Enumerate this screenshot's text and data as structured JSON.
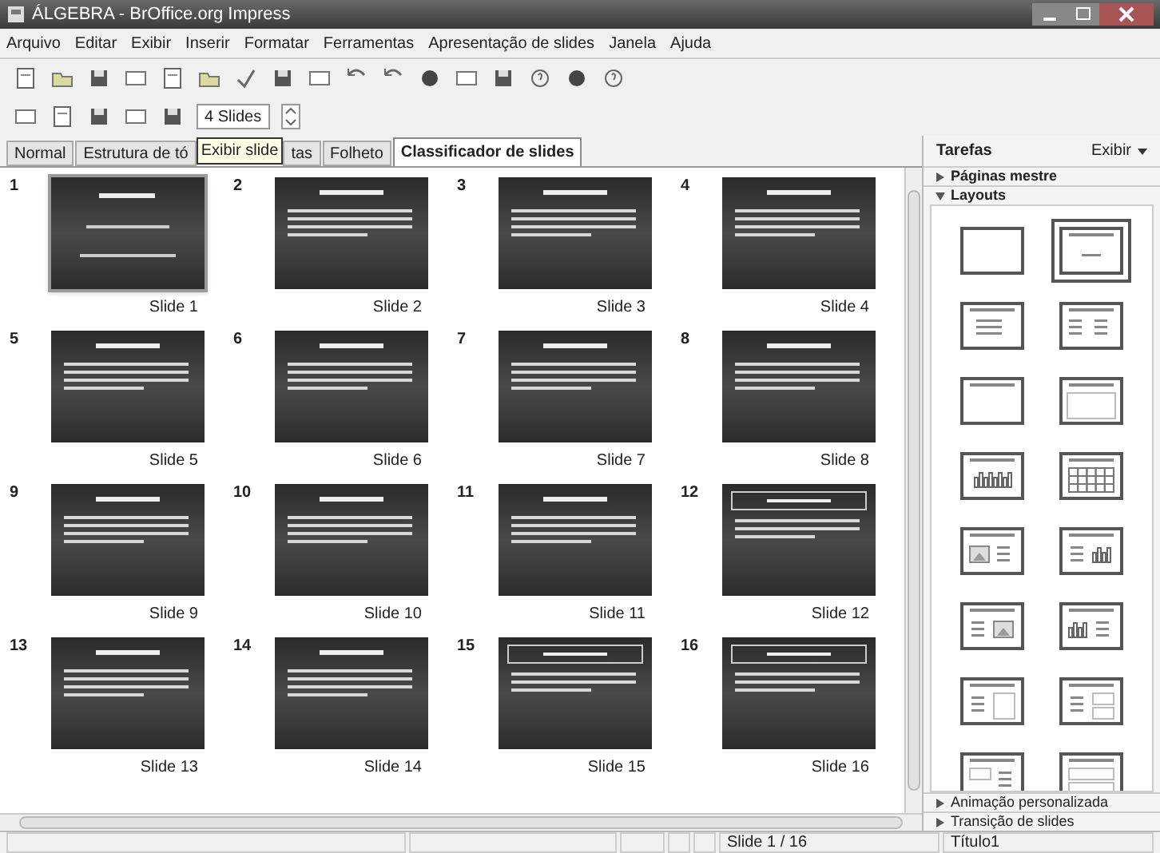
{
  "window": {
    "title": "ÁLGEBRA - BrOffice.org Impress"
  },
  "menu": [
    "Arquivo",
    "Editar",
    "Exibir",
    "Inserir",
    "Formatar",
    "Ferramentas",
    "Apresentação de slides",
    "Janela",
    "Ajuda"
  ],
  "toolbar2": {
    "slides_per_row": "4 Slides"
  },
  "tabs": [
    {
      "label": "Normal",
      "selected": false
    },
    {
      "label": "Estrutura de tó",
      "selected": false
    },
    {
      "label": "tas",
      "selected": false
    },
    {
      "label": "Folheto",
      "selected": false
    },
    {
      "label": "Classificador de slides",
      "selected": true
    }
  ],
  "tooltip": "Exibir slide",
  "slides": [
    {
      "number": "1",
      "label": "Slide 1",
      "kind": "title",
      "selected": true
    },
    {
      "number": "2",
      "label": "Slide 2",
      "kind": "bullets",
      "selected": false
    },
    {
      "number": "3",
      "label": "Slide 3",
      "kind": "bullets",
      "selected": false
    },
    {
      "number": "4",
      "label": "Slide 4",
      "kind": "bullets",
      "selected": false
    },
    {
      "number": "5",
      "label": "Slide 5",
      "kind": "bullets",
      "selected": false
    },
    {
      "number": "6",
      "label": "Slide 6",
      "kind": "bullets",
      "selected": false
    },
    {
      "number": "7",
      "label": "Slide 7",
      "kind": "bullets",
      "selected": false
    },
    {
      "number": "8",
      "label": "Slide 8",
      "kind": "bullets",
      "selected": false
    },
    {
      "number": "9",
      "label": "Slide 9",
      "kind": "bullets",
      "selected": false
    },
    {
      "number": "10",
      "label": "Slide 10",
      "kind": "bullets",
      "selected": false
    },
    {
      "number": "11",
      "label": "Slide 11",
      "kind": "bullets",
      "selected": false
    },
    {
      "number": "12",
      "label": "Slide 12",
      "kind": "boxed",
      "selected": false
    },
    {
      "number": "13",
      "label": "Slide 13",
      "kind": "bullets",
      "selected": false
    },
    {
      "number": "14",
      "label": "Slide 14",
      "kind": "bullets",
      "selected": false
    },
    {
      "number": "15",
      "label": "Slide 15",
      "kind": "boxed",
      "selected": false
    },
    {
      "number": "16",
      "label": "Slide 16",
      "kind": "boxed",
      "selected": false
    }
  ],
  "tasks": {
    "title": "Tarefas",
    "view": "Exibir",
    "sections": [
      {
        "label": "Páginas mestre",
        "expanded": false
      },
      {
        "label": "Layouts",
        "expanded": true
      }
    ],
    "bottom_sections": [
      {
        "label": "Animação personalizada",
        "expanded": false
      },
      {
        "label": "Transição de slides",
        "expanded": false
      }
    ],
    "layouts": [
      {
        "kind": "blank",
        "selected": false
      },
      {
        "kind": "title",
        "selected": true
      },
      {
        "kind": "content",
        "selected": false
      },
      {
        "kind": "two_content",
        "selected": false
      },
      {
        "kind": "title_only",
        "selected": false
      },
      {
        "kind": "centered",
        "selected": false
      },
      {
        "kind": "chart",
        "selected": false
      },
      {
        "kind": "table",
        "selected": false
      },
      {
        "kind": "image_text",
        "selected": false
      },
      {
        "kind": "text_chart",
        "selected": false
      },
      {
        "kind": "text_image",
        "selected": false
      },
      {
        "kind": "chart_text",
        "selected": false
      },
      {
        "kind": "text_blank",
        "selected": false
      },
      {
        "kind": "text_two",
        "selected": false
      },
      {
        "kind": "blank_text",
        "selected": false
      },
      {
        "kind": "title_rows",
        "selected": false
      }
    ]
  },
  "status_bar": {
    "slide": "Slide 1 / 16",
    "layout": "Título1"
  }
}
